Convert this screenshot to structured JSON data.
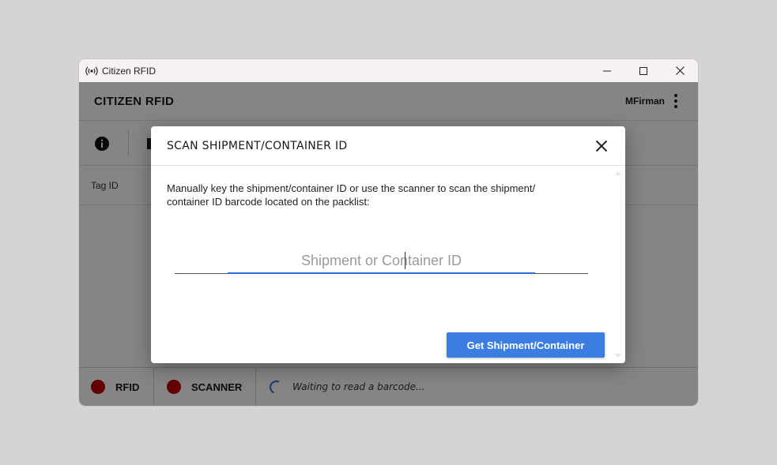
{
  "window": {
    "title": "Citizen RFID"
  },
  "app": {
    "name": "CITIZEN RFID",
    "user": "MFirman",
    "table": {
      "columns": [
        "Tag ID"
      ]
    },
    "status": {
      "rfid_label": "RFID",
      "scanner_label": "SCANNER",
      "message": "Waiting to read a barcode...",
      "rfid_color": "#c00000",
      "scanner_color": "#c00000"
    }
  },
  "modal": {
    "title": "SCAN SHIPMENT/CONTAINER ID",
    "instructions_line1": "Manually key the shipment/container ID or use the scanner to scan the shipment/",
    "instructions_line2": "container ID barcode located on the packlist:",
    "input": {
      "value": "",
      "placeholder": "Shipment or Container ID"
    },
    "submit_label": "Get Shipment/Container"
  },
  "colors": {
    "accent": "#3b7de0",
    "focus_line": "#2e6bd2",
    "status_red": "#c00000"
  },
  "icons": {
    "app": "rfid-broadcast-icon",
    "info": "info-icon",
    "close": "close-icon",
    "menu": "kebab-menu-icon"
  }
}
